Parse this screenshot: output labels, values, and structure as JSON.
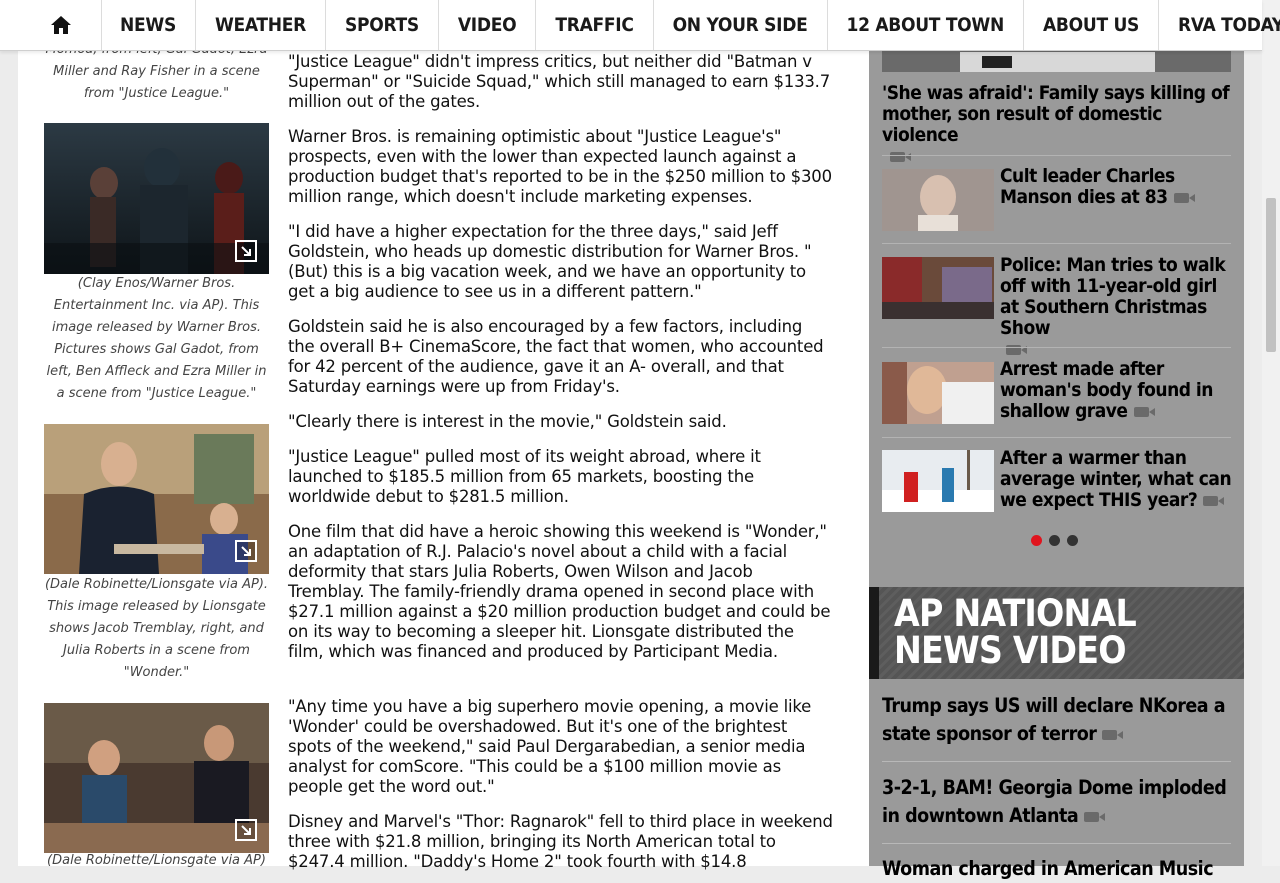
{
  "nav": {
    "home_icon": "home-icon",
    "items": [
      "NEWS",
      "WEATHER",
      "SPORTS",
      "VIDEO",
      "TRAFFIC",
      "ON YOUR SIDE",
      "12 ABOUT TOWN",
      "ABOUT US",
      "RVA TODAY"
    ]
  },
  "captions": {
    "c0_lines": [
      "Momoa, from left, Gal Gadot, Ezra",
      "Miller and Ray Fisher in a scene",
      "from \"Justice League.\""
    ],
    "c1": "(Clay Enos/Warner Bros. Entertainment Inc. via AP). This image released by Warner Bros. Pictures shows Gal Gadot, from left, Ben Affleck and Ezra Miller in a scene from \"Justice League.\"",
    "c2": "(Dale Robinette/Lionsgate via AP). This image released by Lionsgate shows Jacob Tremblay, right, and Julia Roberts in a scene from \"Wonder.\"",
    "c3": "(Dale Robinette/Lionsgate via AP)"
  },
  "article": {
    "p0": "\"Justice League\" didn't impress critics, but neither did \"Batman v Superman\" or \"Suicide Squad,\" which still managed to earn $133.7 million out of the gates.",
    "p1": "Warner Bros. is remaining optimistic about \"Justice League's\" prospects, even with the lower than expected launch against a production budget that's reported to be in the $250 million to $300 million range, which doesn't include marketing expenses.",
    "p2": "\"I did have a higher expectation for the three days,\" said Jeff Goldstein, who heads up domestic distribution for Warner Bros. \"(But) this is a big vacation week, and we have an opportunity to get a big audience to see us in a different pattern.\"",
    "p3": "Goldstein said he is also encouraged by a few factors, including the overall B+ CinemaScore, the fact that women, who accounted for 42 percent of the audience, gave it an A- overall, and that Saturday earnings were up from Friday's.",
    "p4": "\"Clearly there is interest in the movie,\" Goldstein said.",
    "p5": "\"Justice League\" pulled most of its weight abroad, where it launched to $185.5 million from 65 markets, boosting the worldwide debut to $281.5 million.",
    "p6": "One film that did have a heroic showing this weekend is \"Wonder,\" an adaptation of R.J. Palacio's novel about a child with a facial deformity that stars Julia Roberts, Owen Wilson and Jacob Tremblay. The family-friendly drama opened in second place with $27.1 million against a $20 million production budget and could be on its way to becoming a sleeper hit. Lionsgate distributed the film, which was financed and produced by Participant Media.",
    "p7": "\"Any time you have a big superhero movie opening, a movie like 'Wonder' could be overshadowed. But it's one of the brightest spots of the weekend,\" said Paul Dergarabedian, a senior media analyst for comScore. \"This could be a $100 million movie as people get the word out.\"",
    "p8": "Disney and Marvel's \"Thor: Ragnarok\" fell to third place in weekend three with $21.8 million, bringing its North American total to $247.4 million. \"Daddy's Home 2\" took fourth with $14.8"
  },
  "sidebar": {
    "stories": [
      {
        "title": "'She was afraid': Family says killing of mother, son result of domestic violence"
      },
      {
        "title": "Cult leader Charles Manson dies at 83"
      },
      {
        "title": "Police: Man tries to walk off with 11-year-old girl at Southern Christmas Show"
      },
      {
        "title": "Arrest made after woman's body found in shallow grave"
      },
      {
        "title": "After a warmer than average winter, what can we expect THIS year?"
      }
    ],
    "ap_title": "AP NATIONAL NEWS VIDEO",
    "ap_stories": [
      {
        "title": "Trump says US will declare NKorea a state sponsor of terror"
      },
      {
        "title": "3-2-1, BAM! Georgia Dome imploded in downtown Atlanta"
      },
      {
        "title": "Woman charged in American Music"
      }
    ]
  },
  "colors": {
    "accent_red": "#e0141e",
    "sidebar_bg": "#9a9a9a",
    "ap_header_bg": "#555555"
  }
}
